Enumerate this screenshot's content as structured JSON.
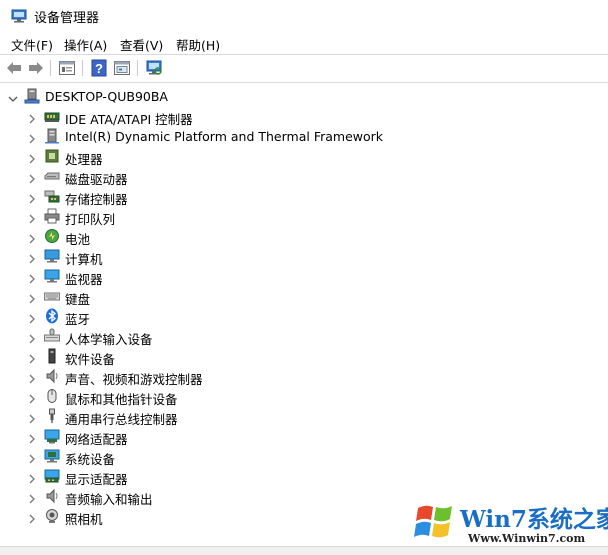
{
  "window": {
    "title": "设备管理器",
    "icon": "device-manager-icon"
  },
  "menu": [
    {
      "label": "文件(F)"
    },
    {
      "label": "操作(A)"
    },
    {
      "label": "查看(V)"
    },
    {
      "label": "帮助(H)"
    }
  ],
  "toolbar": {
    "buttons": [
      "back-arrow-icon",
      "forward-arrow-icon",
      "properties-icon",
      "help-icon",
      "view-resources-icon",
      "scan-hardware-icon"
    ]
  },
  "tree": {
    "root": {
      "label": "DESKTOP-QUB90BA",
      "icon": "computer-tree-icon",
      "expanded": true
    },
    "categories": [
      {
        "label": "IDE ATA/ATAPI 控制器",
        "icon": "ide-controller-icon"
      },
      {
        "label": "Intel(R) Dynamic Platform and Thermal Framework",
        "icon": "thermal-framework-icon"
      },
      {
        "label": "处理器",
        "icon": "processor-icon"
      },
      {
        "label": "磁盘驱动器",
        "icon": "disk-drive-icon"
      },
      {
        "label": "存储控制器",
        "icon": "storage-controller-icon"
      },
      {
        "label": "打印队列",
        "icon": "printer-icon"
      },
      {
        "label": "电池",
        "icon": "battery-icon"
      },
      {
        "label": "计算机",
        "icon": "computer-icon"
      },
      {
        "label": "监视器",
        "icon": "monitor-icon"
      },
      {
        "label": "键盘",
        "icon": "keyboard-icon"
      },
      {
        "label": "蓝牙",
        "icon": "bluetooth-icon"
      },
      {
        "label": "人体学输入设备",
        "icon": "hid-icon"
      },
      {
        "label": "软件设备",
        "icon": "software-device-icon"
      },
      {
        "label": "声音、视频和游戏控制器",
        "icon": "speaker-icon"
      },
      {
        "label": "鼠标和其他指针设备",
        "icon": "mouse-icon"
      },
      {
        "label": "通用串行总线控制器",
        "icon": "usb-icon"
      },
      {
        "label": "网络适配器",
        "icon": "network-adapter-icon"
      },
      {
        "label": "系统设备",
        "icon": "system-device-icon"
      },
      {
        "label": "显示适配器",
        "icon": "display-adapter-icon"
      },
      {
        "label": "音频输入和输出",
        "icon": "audio-io-icon"
      },
      {
        "label": "照相机",
        "icon": "camera-icon"
      }
    ]
  },
  "watermark": {
    "text": "Win7系统之家",
    "url": "Www.Winwin7.com"
  }
}
